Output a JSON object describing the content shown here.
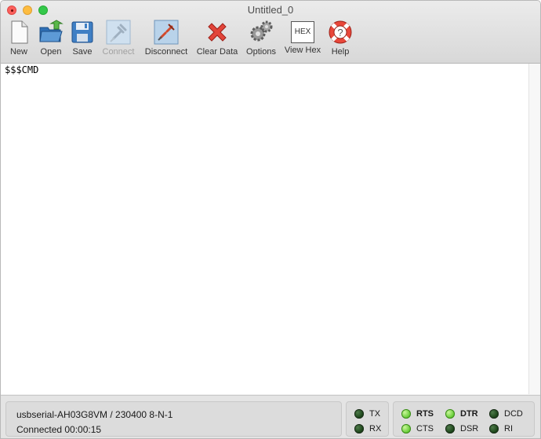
{
  "window": {
    "title": "Untitled_0"
  },
  "toolbar": {
    "buttons": [
      {
        "id": "new",
        "label": "New",
        "icon": "new-document-icon",
        "enabled": true
      },
      {
        "id": "open",
        "label": "Open",
        "icon": "open-folder-icon",
        "enabled": true
      },
      {
        "id": "save",
        "label": "Save",
        "icon": "save-disk-icon",
        "enabled": true
      },
      {
        "id": "connect",
        "label": "Connect",
        "icon": "connect-plug-icon",
        "enabled": false
      },
      {
        "id": "disconnect",
        "label": "Disconnect",
        "icon": "disconnect-plug-icon",
        "enabled": true
      },
      {
        "id": "clear",
        "label": "Clear Data",
        "icon": "red-x-icon",
        "enabled": true
      },
      {
        "id": "options",
        "label": "Options",
        "icon": "gears-icon",
        "enabled": true
      },
      {
        "id": "viewhex",
        "label": "View Hex",
        "icon": "hex-icon",
        "enabled": true
      },
      {
        "id": "help",
        "label": "Help",
        "icon": "lifebuoy-help-icon",
        "enabled": true
      }
    ],
    "hex_icon_text": "HEX"
  },
  "terminal": {
    "text": "$$$CMD"
  },
  "status": {
    "port_info": "usbserial-AH03G8VM / 230400 8-N-1",
    "connected": "Connected 00:00:15"
  },
  "signals": {
    "tx": {
      "label": "TX",
      "on": false
    },
    "rx": {
      "label": "RX",
      "on": false
    },
    "rts": {
      "label": "RTS",
      "on": true
    },
    "cts": {
      "label": "CTS",
      "on": true
    },
    "dtr": {
      "label": "DTR",
      "on": true
    },
    "dsr": {
      "label": "DSR",
      "on": false
    },
    "dcd": {
      "label": "DCD",
      "on": false
    },
    "ri": {
      "label": "RI",
      "on": false
    }
  },
  "colors": {
    "led_on": "#5ac72b",
    "led_off": "#143d12",
    "close": "#fc605c",
    "minimize": "#fdbc40",
    "maximize": "#34c84a"
  }
}
